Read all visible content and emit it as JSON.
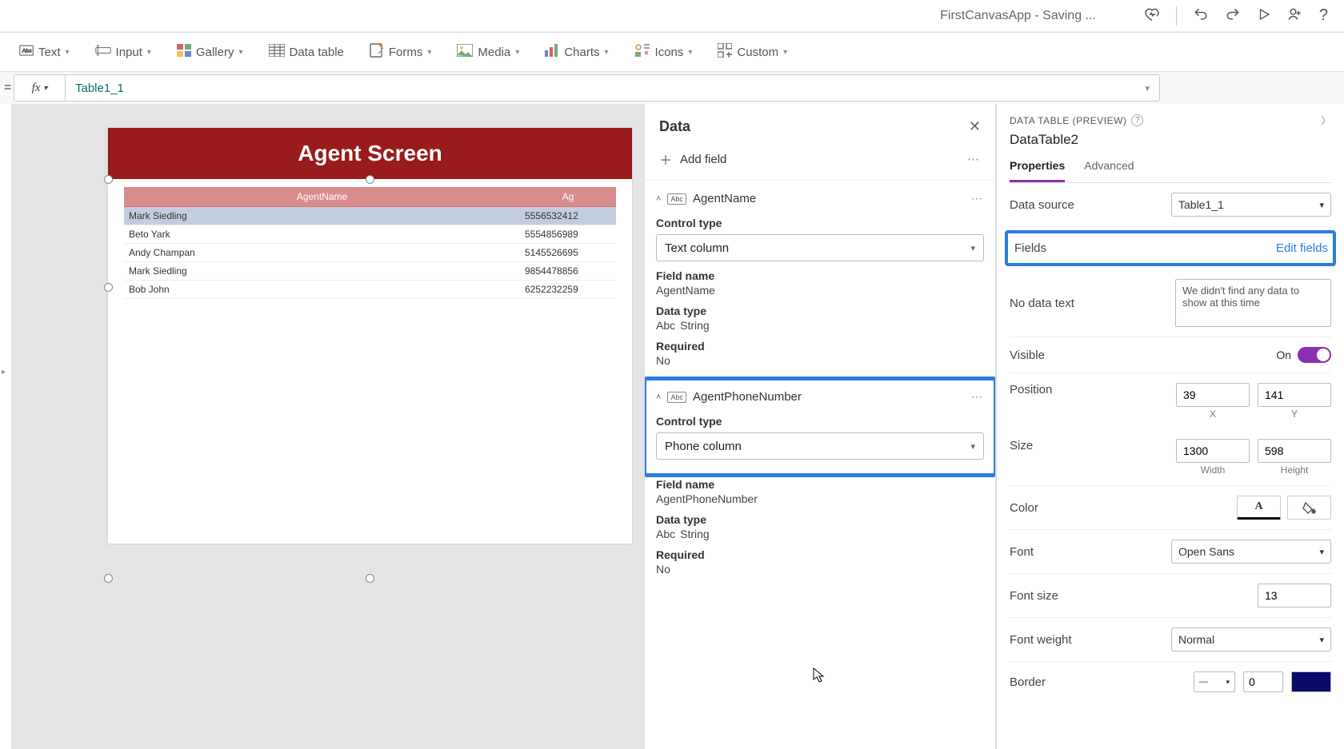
{
  "titlebar": {
    "title": "FirstCanvasApp - Saving ..."
  },
  "ribbon": {
    "text": "Text",
    "input": "Input",
    "gallery": "Gallery",
    "datatable": "Data table",
    "forms": "Forms",
    "media": "Media",
    "charts": "Charts",
    "icons": "Icons",
    "custom": "Custom"
  },
  "formula": {
    "value": "Table1_1"
  },
  "canvas": {
    "screen_title": "Agent Screen",
    "headers": [
      "AgentName",
      "Ag"
    ],
    "rows": [
      {
        "name": "Mark Siedling",
        "phone": "5556532412"
      },
      {
        "name": "Beto Yark",
        "phone": "5554856989"
      },
      {
        "name": "Andy Champan",
        "phone": "5145526695"
      },
      {
        "name": "Mark Siedling",
        "phone": "9854478856"
      },
      {
        "name": "Bob John",
        "phone": "6252232259"
      }
    ]
  },
  "dataPane": {
    "title": "Data",
    "add_field": "Add field",
    "field1": {
      "name": "AgentName",
      "control_type_label": "Control type",
      "control_type_value": "Text column",
      "field_name_label": "Field name",
      "field_name_value": "AgentName",
      "data_type_label": "Data type",
      "data_type_value": "String",
      "required_label": "Required",
      "required_value": "No"
    },
    "field2": {
      "name": "AgentPhoneNumber",
      "control_type_label": "Control type",
      "control_type_value": "Phone column",
      "field_name_label": "Field name",
      "field_name_value": "AgentPhoneNumber",
      "data_type_label": "Data type",
      "data_type_value": "String",
      "required_label": "Required",
      "required_value": "No"
    }
  },
  "propPane": {
    "header": "DATA TABLE (PREVIEW)",
    "control_name": "DataTable2",
    "tab_properties": "Properties",
    "tab_advanced": "Advanced",
    "datasource_label": "Data source",
    "datasource_value": "Table1_1",
    "fields_label": "Fields",
    "edit_fields": "Edit fields",
    "nodata_label": "No data text",
    "nodata_value": "We didn't find any data to show at this time",
    "visible_label": "Visible",
    "visible_value": "On",
    "position_label": "Position",
    "pos_x": "39",
    "pos_y": "141",
    "pos_x_lbl": "X",
    "pos_y_lbl": "Y",
    "size_label": "Size",
    "size_w": "1300",
    "size_h": "598",
    "size_w_lbl": "Width",
    "size_h_lbl": "Height",
    "color_label": "Color",
    "font_label": "Font",
    "font_value": "Open Sans",
    "fontsize_label": "Font size",
    "fontsize_value": "13",
    "fontweight_label": "Font weight",
    "fontweight_value": "Normal",
    "border_label": "Border",
    "border_width": "0"
  }
}
